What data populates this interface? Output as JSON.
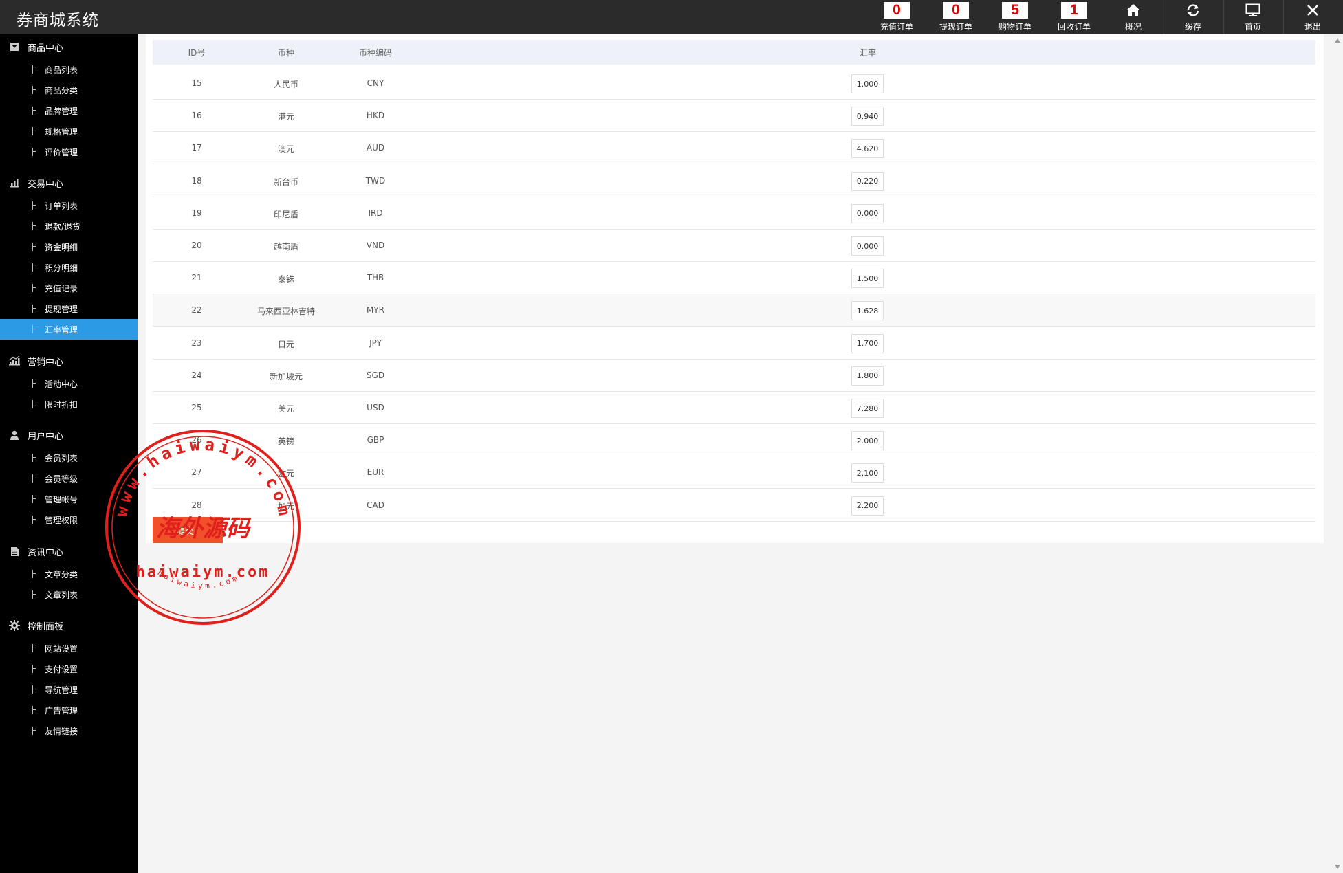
{
  "app": {
    "title": "券商城系统"
  },
  "topbar": {
    "counters": [
      {
        "count": "0",
        "label": "充值订单"
      },
      {
        "count": "0",
        "label": "提现订单"
      },
      {
        "count": "5",
        "label": "购物订单"
      },
      {
        "count": "1",
        "label": "回收订单"
      }
    ],
    "actions": [
      {
        "icon": "home-icon",
        "label": "概况"
      },
      {
        "icon": "refresh-icon",
        "label": "缓存"
      },
      {
        "icon": "monitor-icon",
        "label": "首页"
      },
      {
        "icon": "close-icon",
        "label": "退出"
      }
    ]
  },
  "sidebar": {
    "groups": [
      {
        "title": "商品中心",
        "icon": "box-icon",
        "items": [
          "商品列表",
          "商品分类",
          "品牌管理",
          "规格管理",
          "评价管理"
        ]
      },
      {
        "title": "交易中心",
        "icon": "bar-chart-icon",
        "items": [
          "订单列表",
          "退款/退货",
          "资金明细",
          "积分明细",
          "充值记录",
          "提现管理",
          "汇率管理"
        ]
      },
      {
        "title": "营销中心",
        "icon": "stats-icon",
        "items": [
          "活动中心",
          "限时折扣"
        ]
      },
      {
        "title": "用户中心",
        "icon": "user-icon",
        "items": [
          "会员列表",
          "会员等级",
          "管理帐号",
          "管理权限"
        ]
      },
      {
        "title": "资讯中心",
        "icon": "document-icon",
        "items": [
          "文章分类",
          "文章列表"
        ]
      },
      {
        "title": "控制面板",
        "icon": "gear-icon",
        "items": [
          "网站设置",
          "支付设置",
          "导航管理",
          "广告管理",
          "友情链接"
        ]
      }
    ],
    "active_item": "汇率管理"
  },
  "table": {
    "columns": [
      "ID号",
      "币种",
      "币种编码",
      "汇率"
    ],
    "rows": [
      {
        "id": "15",
        "name": "人民币",
        "code": "CNY",
        "rate": "1.000"
      },
      {
        "id": "16",
        "name": "港元",
        "code": "HKD",
        "rate": "0.940"
      },
      {
        "id": "17",
        "name": "澳元",
        "code": "AUD",
        "rate": "4.620"
      },
      {
        "id": "18",
        "name": "新台币",
        "code": "TWD",
        "rate": "0.220"
      },
      {
        "id": "19",
        "name": "印尼盾",
        "code": "IRD",
        "rate": "0.000"
      },
      {
        "id": "20",
        "name": "越南盾",
        "code": "VND",
        "rate": "0.000"
      },
      {
        "id": "21",
        "name": "泰铢",
        "code": "THB",
        "rate": "1.500"
      },
      {
        "id": "22",
        "name": "马来西亚林吉特",
        "code": "MYR",
        "rate": "1.628"
      },
      {
        "id": "23",
        "name": "日元",
        "code": "JPY",
        "rate": "1.700"
      },
      {
        "id": "24",
        "name": "新加坡元",
        "code": "SGD",
        "rate": "1.800"
      },
      {
        "id": "25",
        "name": "美元",
        "code": "USD",
        "rate": "7.280"
      },
      {
        "id": "26",
        "name": "英镑",
        "code": "GBP",
        "rate": "2.000"
      },
      {
        "id": "27",
        "name": "欧元",
        "code": "EUR",
        "rate": "2.100"
      },
      {
        "id": "28",
        "name": "加元",
        "code": "CAD",
        "rate": "2.200"
      }
    ]
  },
  "submit_label": "提交",
  "watermark": {
    "ring_text": "www.haiwaiym.com",
    "center_text": "海外源码",
    "url_text": "haiwaiym.com",
    "small_text": "haiwaiym.com",
    "color": "#e0201c"
  },
  "colors": {
    "topbar": "#2b2b2b",
    "sidebar": "#000000",
    "active": "#2d9ae6",
    "badge_text": "#dd0000",
    "submit": "#f2502a"
  }
}
